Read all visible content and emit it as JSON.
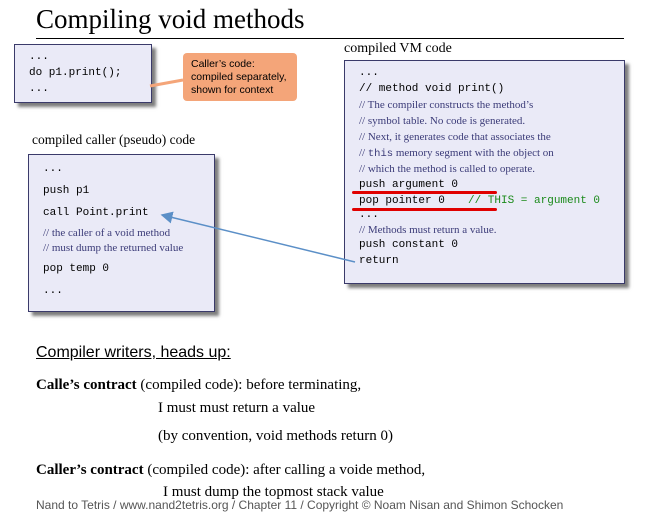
{
  "title": "Compiling void methods",
  "caller_box": {
    "lines": [
      "...",
      "do p1.print();",
      "..."
    ]
  },
  "callout": {
    "lines": [
      "Caller’s code:",
      "compiled separately,",
      "shown for context"
    ]
  },
  "vm_label": "compiled VM code",
  "vm_box": {
    "l1": "...",
    "l2": "// method void print()",
    "c1": "// The compiler constructs the method’s",
    "c2": "// symbol table. No code is generated.",
    "c3": "// Next, it generates code that associates the",
    "c4a": "// ",
    "c4b": "this",
    "c4c": " memory segment with the object on",
    "c5": "// which the method is called to operate.",
    "push_arg": "push argument 0",
    "pop_ptr": "pop pointer 0",
    "pop_ptr_cmt": "// THIS = argument 0",
    "dots": "...",
    "c6": "// Methods must return a value.",
    "push_const": "push constant 0",
    "ret": "return"
  },
  "pseudo_label": "compiled caller (pseudo) code",
  "pseudo_box": {
    "l1": "...",
    "l2": "push p1",
    "l3": "call Point.print",
    "c1": "// the caller of a void method",
    "c2": "// must dump the returned value",
    "l4": "pop temp 0",
    "l5": "..."
  },
  "headsup": "Compiler writers, heads up:",
  "callee": {
    "bold": "Calle’s contract",
    "rest": " (compiled code): before terminating,",
    "l2": "I must must return a value",
    "l3": "(by convention, void methods return 0)"
  },
  "caller": {
    "bold": "Caller’s contract",
    "rest": " (compiled code): after calling a voide method,",
    "l2": "I must dump the topmost stack value"
  },
  "footer": "Nand to Tetris / www.nand2tetris.org / Chapter 11 / Copyright © Noam Nisan and Shimon Schocken",
  "colors": {
    "box_bg": "#eaeaf7",
    "callout": "#f4a579",
    "arrow": "#5b8fc7",
    "highlight": "#e00000",
    "comment_green": "#1a8a1a"
  }
}
